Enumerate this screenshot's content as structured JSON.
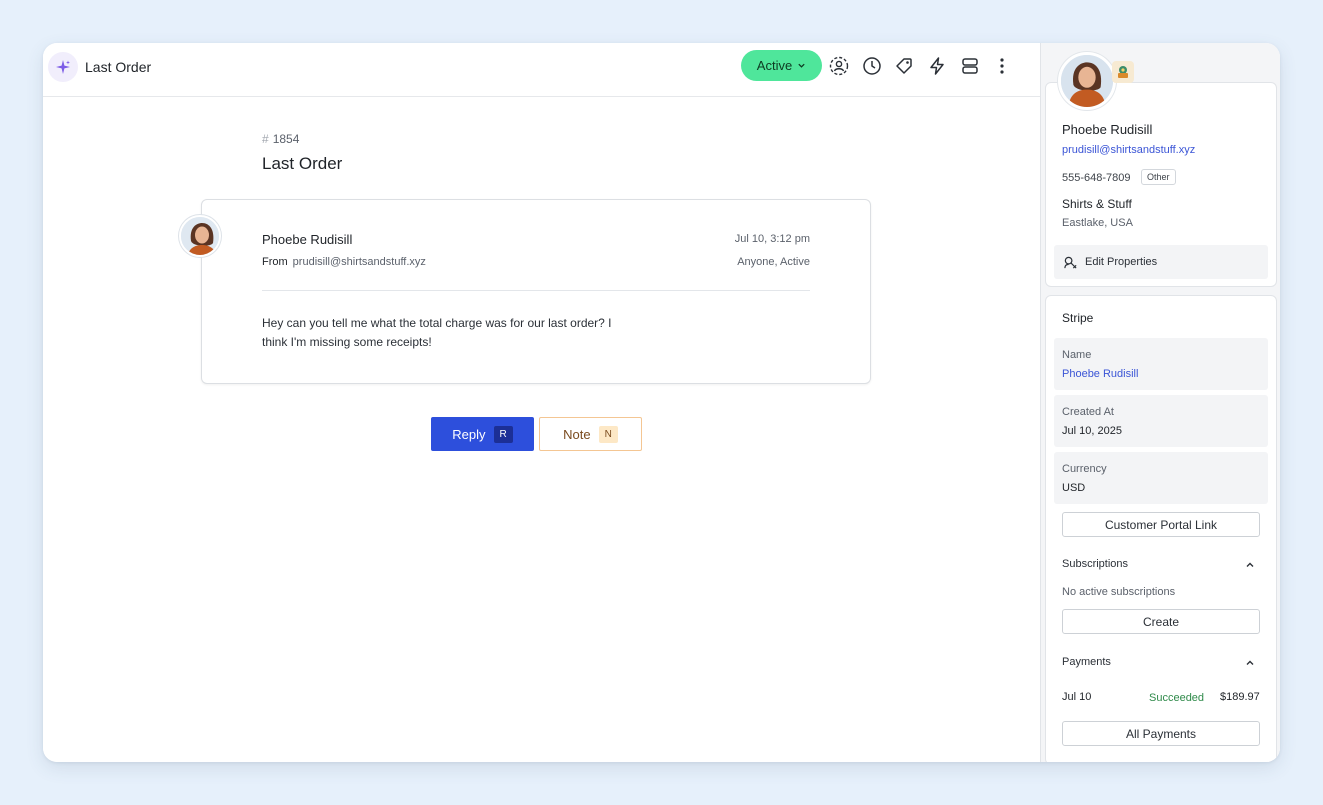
{
  "colors": {
    "accent": "#2d4fdc",
    "status_active": "#4fe69b",
    "link": "#3b55d6",
    "success": "#2f8a4a",
    "note_border": "#f4c693"
  },
  "topbar": {
    "title": "Last Order",
    "status_label": "Active",
    "icons": [
      "ai-sparkle-icon",
      "assignee-icon",
      "clock-icon",
      "tag-icon",
      "lightning-icon",
      "layout-icon",
      "more-icon"
    ]
  },
  "conversation": {
    "number": "1854",
    "hash": "#",
    "title": "Last Order"
  },
  "message": {
    "sender": "Phoebe Rudisill",
    "from_label": "From",
    "from_email": "prudisill@shirtsandstuff.xyz",
    "time": "Jul 10, 3:12 pm",
    "audience": "Anyone, Active",
    "body_line1": "Hey can you tell me what the total charge was for our last order? I",
    "body_line2": "think I'm missing some receipts!"
  },
  "actions": {
    "reply_label": "Reply",
    "reply_key": "R",
    "note_label": "Note",
    "note_key": "N"
  },
  "contact": {
    "name": "Phoebe Rudisill",
    "email": "prudisill@shirtsandstuff.xyz",
    "phone": "555-648-7809",
    "phone_tag": "Other",
    "company": "Shirts & Stuff",
    "location": "Eastlake, USA",
    "edit_label": "Edit Properties"
  },
  "stripe": {
    "title": "Stripe",
    "fields": [
      {
        "label": "Name",
        "value": "Phoebe Rudisill"
      },
      {
        "label": "Created At",
        "value": "Jul 10, 2025"
      },
      {
        "label": "Currency",
        "value": "USD"
      }
    ],
    "portal_button": "Customer Portal Link",
    "subscriptions": {
      "title": "Subscriptions",
      "empty_text": "No active subscriptions",
      "create_button": "Create"
    },
    "payments": {
      "title": "Payments",
      "rows": [
        {
          "date": "Jul 10",
          "status": "Succeeded",
          "amount": "$189.97"
        }
      ],
      "all_button": "All Payments"
    }
  }
}
